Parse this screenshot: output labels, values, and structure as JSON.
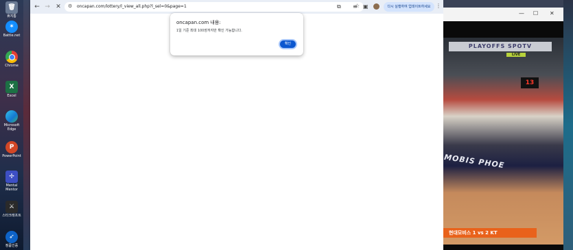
{
  "desktop": {
    "icons": [
      {
        "label": "휴지통",
        "color": "#6b7b94"
      },
      {
        "label": "Battle.net",
        "color": "#148eff"
      },
      {
        "label": "Chrome",
        "color": "#e44134"
      },
      {
        "label": "Excel",
        "color": "#1d7044"
      },
      {
        "label": "Microsoft Edge",
        "color": "#1479d2"
      },
      {
        "label": "PowerPoint",
        "color": "#d24726"
      },
      {
        "label": "Mental Mentor",
        "color": "#3d4fc4"
      },
      {
        "label": "스타크래프트",
        "color": "#2a2a2a"
      },
      {
        "label": "정품인증",
        "color": "#0e63c7"
      }
    ]
  },
  "browser": {
    "url": "oncapan.com/lottery/l_view_all.php?l_sel=0&page=1",
    "restart_label": "다시 실행하여 업데이트하세요"
  },
  "dialog": {
    "title": "oncapan.com 내용:",
    "message": "1일 기준 최대 100장까지만 확인 가능합니다.",
    "ok_label": "확인"
  },
  "video": {
    "banner": "PLAYOFFS SPOTV",
    "live": "LIVE",
    "shot_clock": "13",
    "ad_text": "MOBIS PHOE",
    "score": "현대모비스 1 vs 2 KT"
  },
  "colors": {
    "accent": "#0b57d0",
    "toolbar": "#e9eef6",
    "scorebar": "#e9621b"
  }
}
